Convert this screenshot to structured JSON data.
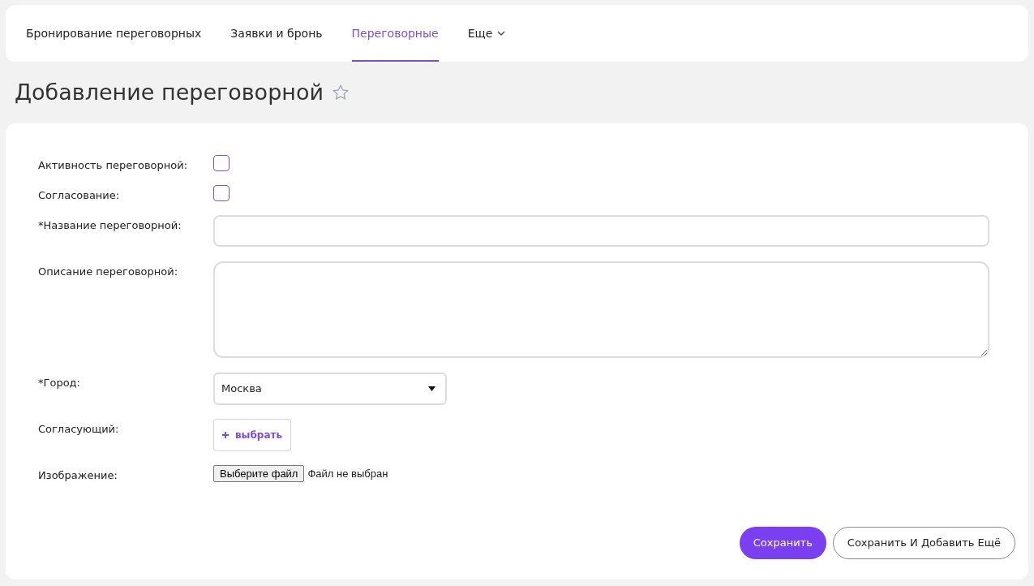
{
  "nav": {
    "tabs": [
      {
        "label": "Бронирование переговорных",
        "selected": false,
        "kind": "link"
      },
      {
        "label": "Заявки и бронь",
        "selected": false,
        "kind": "link"
      },
      {
        "label": "Переговорные",
        "selected": true,
        "kind": "link"
      },
      {
        "label": "Еще",
        "selected": false,
        "kind": "dropdown"
      }
    ]
  },
  "page": {
    "title": "Добавление переговорной",
    "favorite": false
  },
  "form": {
    "fields": [
      {
        "kind": "checkbox",
        "label": "Активность переговорной:",
        "checked": false
      },
      {
        "kind": "checkbox",
        "label": "Согласование:",
        "checked": false
      },
      {
        "kind": "text",
        "label": "*Название переговорной:"
      },
      {
        "kind": "textarea",
        "label": "Описание переговорной:"
      },
      {
        "kind": "select",
        "label": "*Город:",
        "value": "Москва"
      },
      {
        "kind": "picker",
        "label": "Согласующий:",
        "button": "выбрать"
      },
      {
        "kind": "file",
        "label": "Изображение:",
        "button": "Выберите файл",
        "status": "Файл не выбран"
      }
    ],
    "buttons": [
      {
        "label": "Сохранить",
        "kind": "primary"
      },
      {
        "label": "Сохранить И Добавить Ещё",
        "kind": "secondary"
      }
    ]
  }
}
